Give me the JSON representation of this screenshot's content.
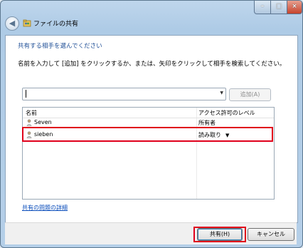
{
  "window": {
    "title": "ファイルの共有",
    "controls": {
      "minimize": "–",
      "maximize": "□",
      "close": "×"
    }
  },
  "heading": "共有する相手を選んでください",
  "instruction": "名前を入力して [追加] をクリックするか、または、矢印をクリックして相手を検索してください。",
  "input": {
    "value": "",
    "dropdown_arrow": "▼"
  },
  "add_button": "追加(A)",
  "list": {
    "columns": [
      "名前",
      "アクセス許可のレベル"
    ],
    "rows": [
      {
        "name": "Seven",
        "level": "所有者",
        "icon": "user-icon"
      },
      {
        "name": "sieben",
        "level": "読み取り",
        "level_arrow": "▼",
        "icon": "user-icon"
      }
    ]
  },
  "help_link": "共有の問題の詳細",
  "buttons": {
    "share": "共有(H)",
    "cancel": "キャンセル"
  },
  "colors": {
    "heading": "#1e4e96",
    "link": "#0a4dbb",
    "highlight_border": "#e0001b"
  }
}
